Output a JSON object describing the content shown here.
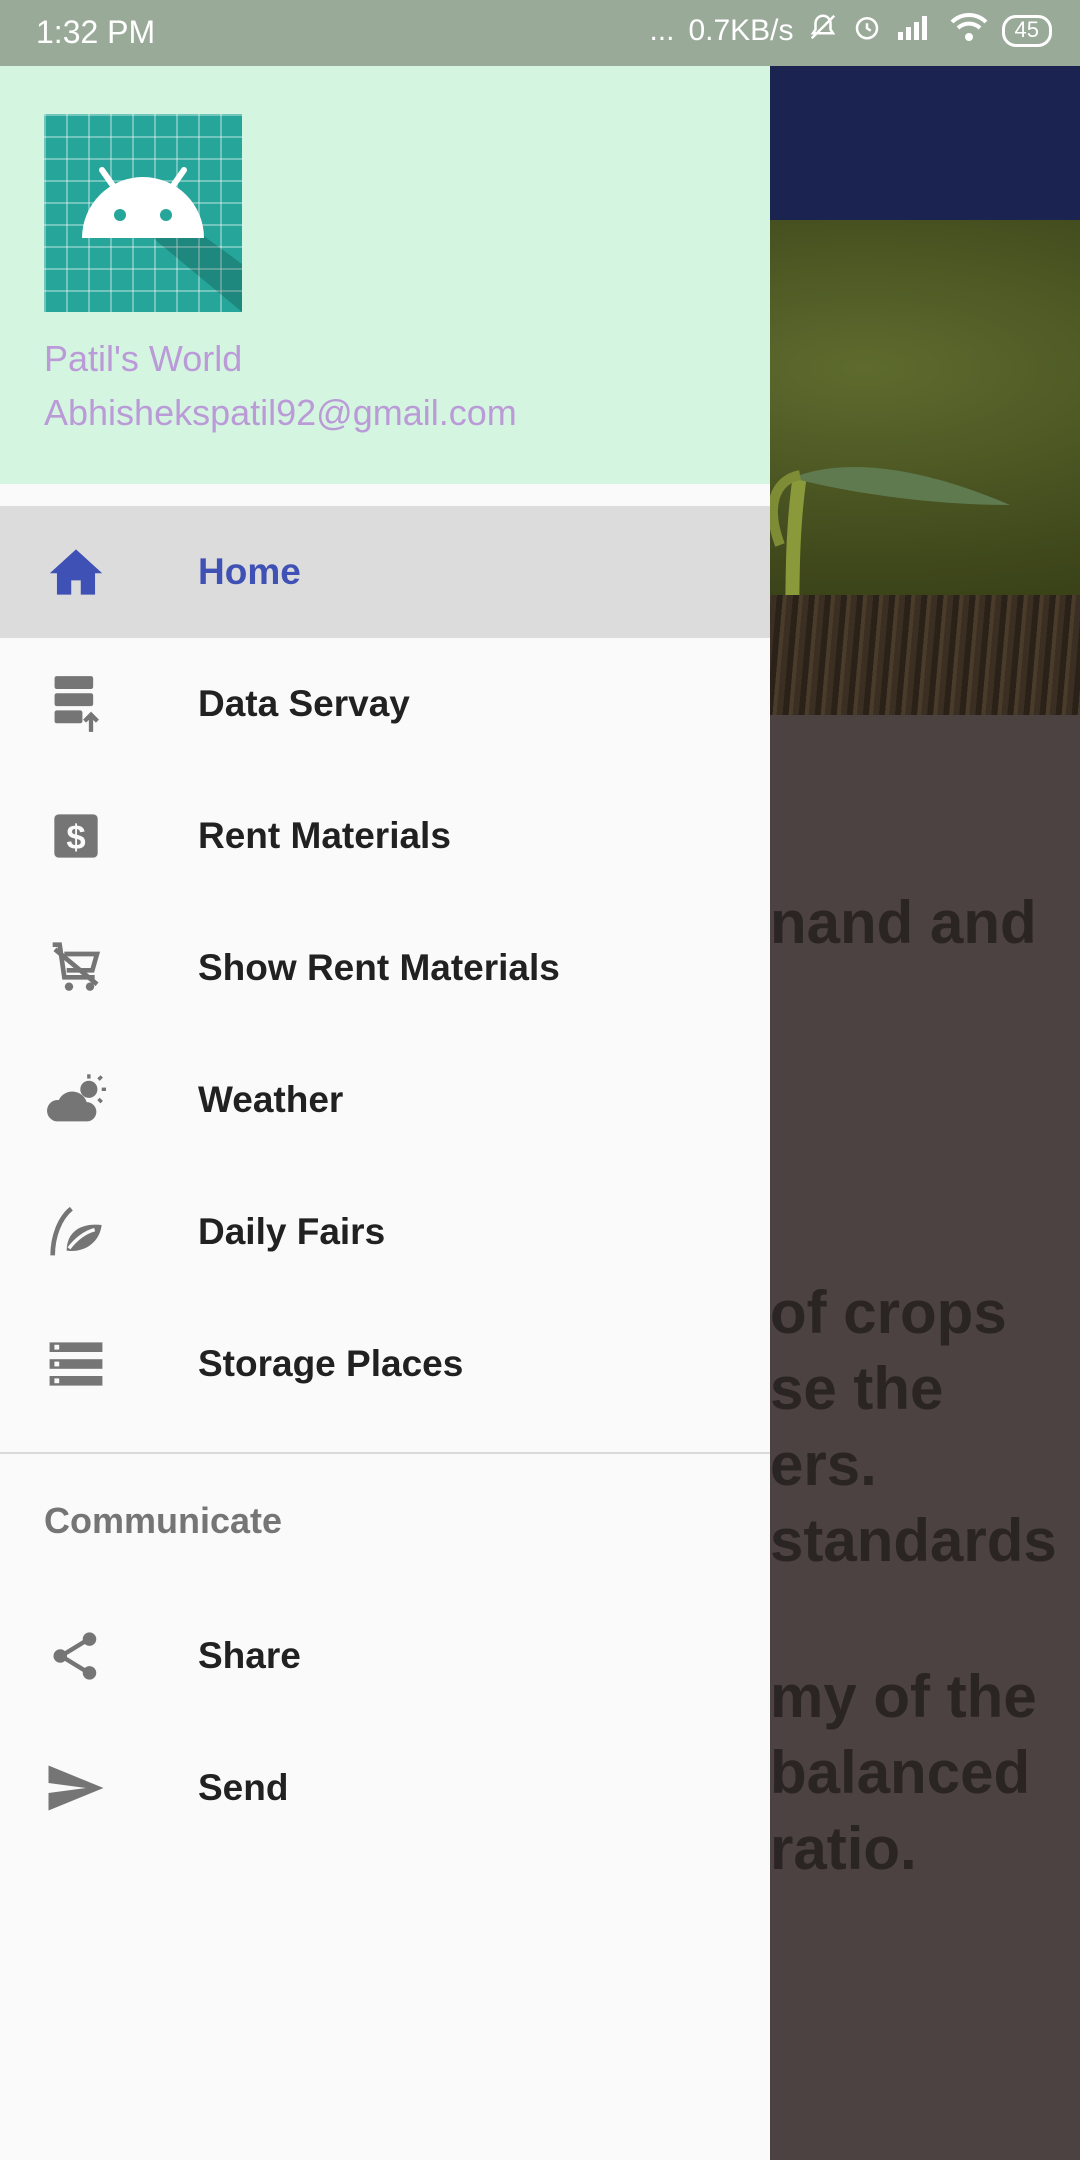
{
  "status_bar": {
    "time": "1:32 PM",
    "dots": "...",
    "network_speed": "0.7KB/s",
    "battery": "45"
  },
  "drawer": {
    "header": {
      "title": "Patil's World",
      "email": "Abhishekspatil92@gmail.com"
    },
    "items": [
      {
        "label": "Home",
        "icon": "home-icon",
        "active": true
      },
      {
        "label": "Data Servay",
        "icon": "database-upload-icon"
      },
      {
        "label": "Rent Materials",
        "icon": "dollar-icon"
      },
      {
        "label": "Show Rent Materials",
        "icon": "cart-off-icon"
      },
      {
        "label": "Weather",
        "icon": "weather-icon"
      },
      {
        "label": "Daily Fairs",
        "icon": "leaf-hand-icon"
      },
      {
        "label": "Storage Places",
        "icon": "storage-icon"
      }
    ],
    "section_title": "Communicate",
    "section_items": [
      {
        "label": "Share",
        "icon": "share-icon"
      },
      {
        "label": "Send",
        "icon": "send-icon"
      }
    ]
  },
  "background": {
    "lines": [
      "nand and",
      "of crops",
      "se the",
      "ers.",
      "standards",
      "my of the",
      "balanced",
      "ratio."
    ]
  },
  "colors": {
    "header_bg": "#d4f5e0",
    "accent": "#3f51b5",
    "header_text": "#bb9ad8",
    "toolbar": "#1b2351"
  }
}
